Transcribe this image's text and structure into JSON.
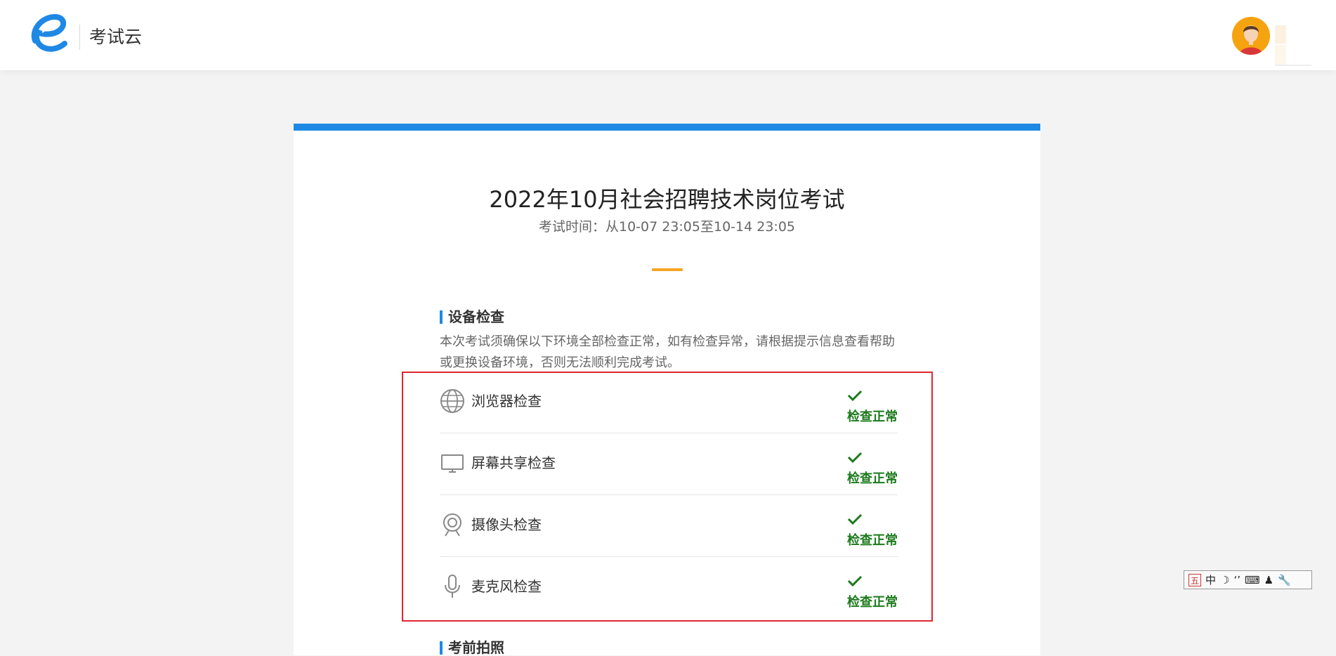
{
  "header": {
    "app_name": "考试云"
  },
  "exam": {
    "title": "2022年10月社会招聘技术岗位考试",
    "time": "考试时间：从10-07 23:05至10-14 23:05"
  },
  "device_check": {
    "title": "设备检查",
    "description": "本次考试须确保以下环境全部检查正常，如有检查异常，请根据提示信息查看帮助或更换设备环境，否则无法顺利完成考试。",
    "items": [
      {
        "icon": "globe-icon",
        "label": "浏览器检查",
        "status": "检查正常"
      },
      {
        "icon": "monitor-icon",
        "label": "屏幕共享检查",
        "status": "检查正常"
      },
      {
        "icon": "webcam-icon",
        "label": "摄像头检查",
        "status": "检查正常"
      },
      {
        "icon": "microphone-icon",
        "label": "麦克风检查",
        "status": "检查正常"
      }
    ],
    "status_color": "#1b7a1b"
  },
  "pre_exam_photo": {
    "title": "考前拍照"
  },
  "ime_toolbar": {
    "mode_label": "五",
    "language_label": "中"
  },
  "colors": {
    "accent_blue": "#1e88e5",
    "accent_orange": "#f5a623",
    "highlight_red": "#e0262e"
  }
}
